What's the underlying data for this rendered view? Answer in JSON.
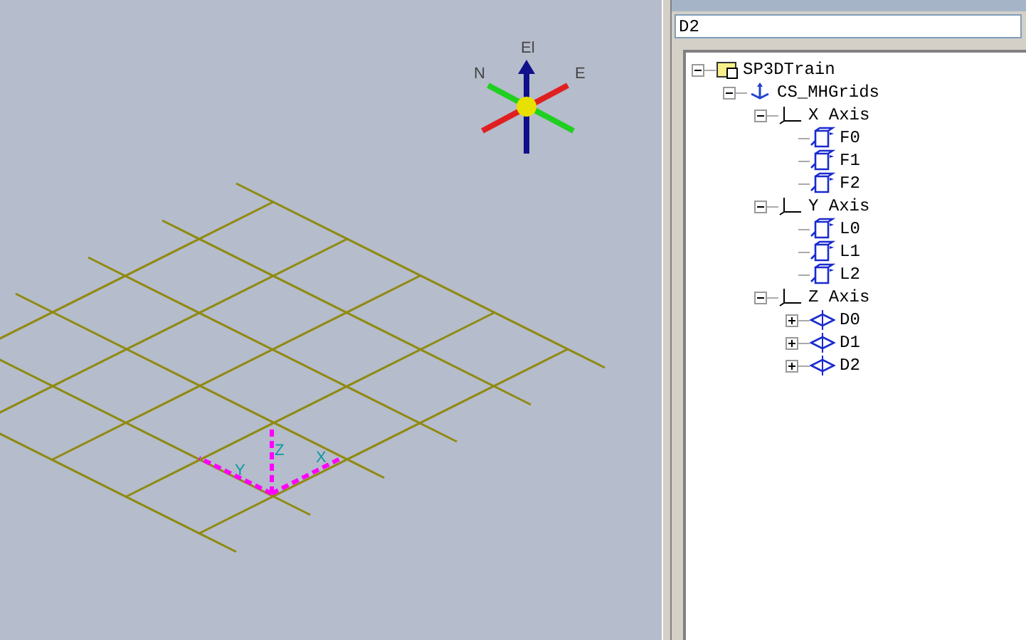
{
  "viewport": {
    "compass_labels": [
      "El",
      "N",
      "E"
    ],
    "triad_labels": [
      "Y",
      "Z",
      "X"
    ]
  },
  "explorer": {
    "search_value": "D2",
    "tree": [
      {
        "label": "SP3DTrain",
        "kind": "root",
        "expanded": true,
        "children": [
          {
            "label": "CS_MHGrids",
            "kind": "coordinate-system",
            "expanded": true,
            "children": [
              {
                "label": "X Axis",
                "kind": "axis",
                "expanded": true,
                "children": [
                  {
                    "label": "F0",
                    "kind": "plane"
                  },
                  {
                    "label": "F1",
                    "kind": "plane"
                  },
                  {
                    "label": "F2",
                    "kind": "plane"
                  }
                ]
              },
              {
                "label": "Y Axis",
                "kind": "axis",
                "expanded": true,
                "children": [
                  {
                    "label": "L0",
                    "kind": "plane"
                  },
                  {
                    "label": "L1",
                    "kind": "plane"
                  },
                  {
                    "label": "L2",
                    "kind": "plane"
                  }
                ]
              },
              {
                "label": "Z Axis",
                "kind": "axis",
                "expanded": true,
                "children": [
                  {
                    "label": "D0",
                    "kind": "elevation",
                    "expanded": false
                  },
                  {
                    "label": "D1",
                    "kind": "elevation",
                    "expanded": false
                  },
                  {
                    "label": "D2",
                    "kind": "elevation",
                    "expanded": false
                  }
                ]
              }
            ]
          }
        ]
      }
    ]
  }
}
